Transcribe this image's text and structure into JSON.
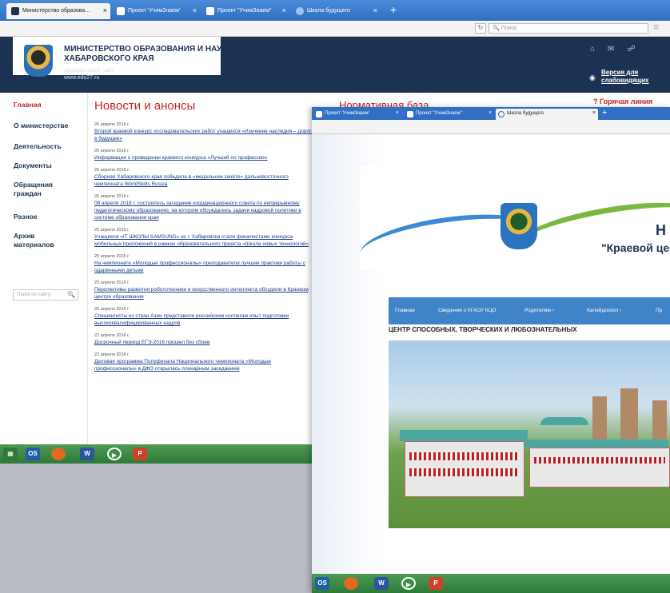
{
  "window1": {
    "tabs": [
      {
        "title": "Министерство образова…",
        "active": true
      },
      {
        "title": "Проект 'УчимЗнаем'",
        "active": false
      },
      {
        "title": "Проект \"УчимЗнаем\"",
        "active": false
      },
      {
        "title": "Школа будущего",
        "active": false
      }
    ],
    "search_placeholder": "Поиск",
    "header": {
      "title_line1": "МИНИСТЕРСТВО ОБРАЗОВАНИЯ И НАУКИ",
      "title_line2": "ХАБАРОВСКОГО КРАЯ",
      "subtitle1": "официальный сайт",
      "subtitle2": "www.edu27.ru",
      "accessibility_line1": "Версия для",
      "accessibility_line2": "слабовидящих",
      "hotline": "Горячая линия"
    },
    "sidebar": [
      {
        "label": "Главная",
        "active": true
      },
      {
        "label": "О министерстве",
        "active": false
      },
      {
        "label": "Деятельность",
        "active": false
      },
      {
        "label": "Документы",
        "active": false
      },
      {
        "label": "Обращения граждан",
        "active": false
      },
      {
        "label": "Разное",
        "active": false
      },
      {
        "label": "Архив материалов",
        "active": false
      }
    ],
    "sidebar_search_placeholder": "Поиск по сайту",
    "news_heading": "Новости и анонсы",
    "norm_heading": "Нормативная база",
    "news": [
      {
        "date": "26 апреля 2016 г.",
        "text": "Второй краевой конкурс исследовательских работ учащихся «Изучение наследия – дорога в будущее»"
      },
      {
        "date": "26 апреля 2016 г.",
        "text": "Информация о проведении краевого конкурса «Лучший по профессии»"
      },
      {
        "date": "26 апреля 2016 г.",
        "text": "Сборная Хабаровского края победила в «медальном зачёте» дальневосточного чемпионата WorldSkills Russia"
      },
      {
        "date": "26 апреля 2016 г.",
        "text": "08 апреля 2016 г. состоялось заседание координационного совета по непрерывному педагогическому образованию, на котором обсуждались задачи кадровой политики в системе образования края"
      },
      {
        "date": "25 апреля 2016 г.",
        "text": "Учащиеся «IT ШКОЛЫ SAMSUNG» из г. Хабаровска стали финалистами конкурса мобильных приложений в рамках образовательного проекта «Школа новых технологий»"
      },
      {
        "date": "25 апреля 2016 г.",
        "text": "На чемпионате «Молодые профессионалы» преподаватели лучшие практики работы с одарёнными детьми"
      },
      {
        "date": "25 апреля 2016 г.",
        "text": "Перспективы развития робототехники и искусственного интеллекта обсудили в Краевом центре образования"
      },
      {
        "date": "25 апреля 2016 г.",
        "text": "Специалисты из стран Азии представили российским коллегам опыт подготовки высококвалифицированных кадров"
      },
      {
        "date": "22 апреля 2016 г.",
        "text": "Досрочный период ЕГЭ-2016 прошел без сбоев"
      },
      {
        "date": "22 апреля 2016 г.",
        "text": "Деловая программа Полуфинала Национального чемпионата «Молодые профессионалы» в ДФО открылась пленарным заседанием"
      }
    ]
  },
  "window2": {
    "tabs": [
      {
        "title": "Проект 'УчимЗнаем'",
        "active": false
      },
      {
        "title": "Проект \"УчимЗнаем\"",
        "active": false
      },
      {
        "title": "Школа будущего",
        "active": true
      }
    ],
    "banner_letter": "Н",
    "banner_text": "\"Краевой це",
    "menu": [
      "Главная",
      "Сведения о КГАОУ КЦО",
      "Родителям ›",
      "Калейдоскоп ›",
      "Пр"
    ],
    "section_heading": "ЦЕНТР СПОСОБНЫХ, ТВОРЧЕСКИХ И ЛЮБОЗНАТЕЛЬНЫХ"
  },
  "taskbar": {
    "icons": [
      "os-icon",
      "firefox-icon",
      "word-icon",
      "media-player-icon",
      "powerpoint-icon"
    ]
  },
  "colors": {
    "header_navy": "#1c3253",
    "accent_red": "#c4241f",
    "taskbar_green": "#3f8a47",
    "menu_blue": "#3f83c8",
    "link_blue": "#1a3d8a"
  }
}
